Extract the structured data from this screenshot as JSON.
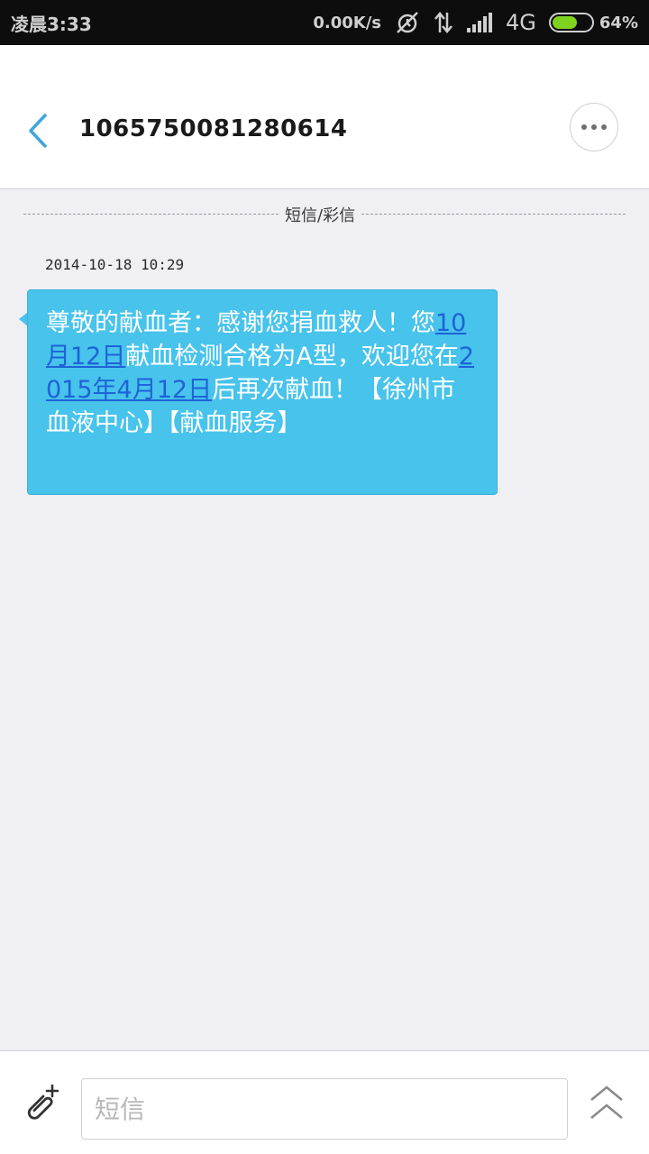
{
  "status_bar": {
    "time": "凌晨3:33",
    "network_speed": "0.00K/s",
    "network_type": "4G",
    "battery_percent": "64%",
    "battery_level": 0.64,
    "battery_color": "#7ed321"
  },
  "header": {
    "back_icon": "chevron-left-icon",
    "title": "1065750081280614",
    "more_icon": "more-dots-icon"
  },
  "conversation": {
    "channel_label": "短信/彩信",
    "messages": [
      {
        "timestamp": "2014-10-18  10:29",
        "text_parts": [
          {
            "text": "尊敬的献血者：感谢您捐血救人！您",
            "link": false
          },
          {
            "text": "10月12日",
            "link": true
          },
          {
            "text": "献血检测合格为A型，欢迎您在",
            "link": false
          },
          {
            "text": "2015年4月12日",
            "link": true
          },
          {
            "text": "后再次献血！【徐州市血液中心】【献血服务】",
            "link": false
          }
        ]
      }
    ],
    "bubble_color": "#47c3ec",
    "link_color": "#1e63d6"
  },
  "composer": {
    "attach_icon": "paperclip-plus-icon",
    "input_placeholder": "短信",
    "input_value": "",
    "expand_icon": "double-chevron-up-icon"
  }
}
